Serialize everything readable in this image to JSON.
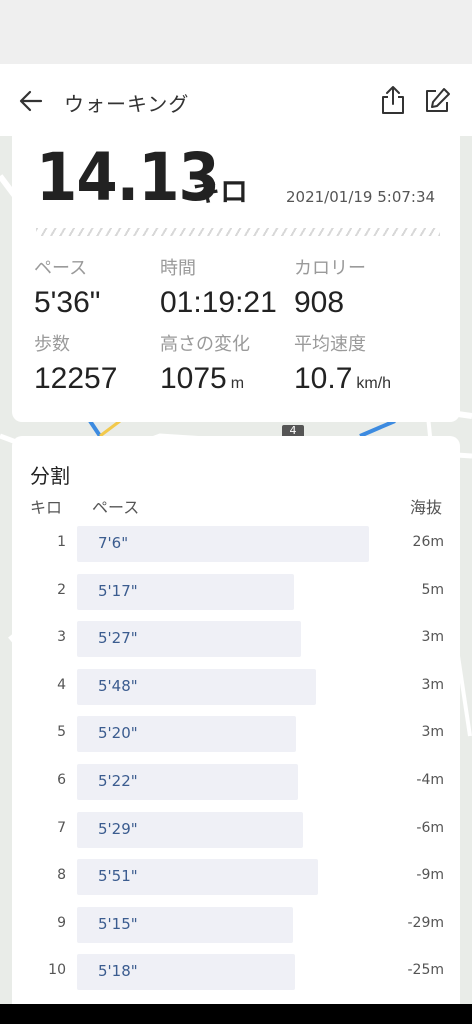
{
  "header": {
    "title": "ウォーキング"
  },
  "summary": {
    "distance": "14.13",
    "distance_unit": "キロ",
    "datetime": "2021/01/19 5:07:34",
    "stats": [
      {
        "label": "ペース",
        "value": "5'36\"",
        "unit": ""
      },
      {
        "label": "時間",
        "value": "01:19:21",
        "unit": ""
      },
      {
        "label": "カロリー",
        "value": "908",
        "unit": ""
      },
      {
        "label": "歩数",
        "value": "12257",
        "unit": ""
      },
      {
        "label": "高さの変化",
        "value": "1075",
        "unit": "m"
      },
      {
        "label": "平均速度",
        "value": "10.7",
        "unit": "km/h"
      }
    ]
  },
  "splits": {
    "title": "分割",
    "col_km": "キロ",
    "col_pace": "ペース",
    "col_elev": "海抜",
    "rows": [
      {
        "km": "1",
        "pace": "7'6\"",
        "pace_sec": 426,
        "elev": "26m"
      },
      {
        "km": "2",
        "pace": "5'17\"",
        "pace_sec": 317,
        "elev": "5m"
      },
      {
        "km": "3",
        "pace": "5'27\"",
        "pace_sec": 327,
        "elev": "3m"
      },
      {
        "km": "4",
        "pace": "5'48\"",
        "pace_sec": 348,
        "elev": "3m"
      },
      {
        "km": "5",
        "pace": "5'20\"",
        "pace_sec": 320,
        "elev": "3m"
      },
      {
        "km": "6",
        "pace": "5'22\"",
        "pace_sec": 322,
        "elev": "-4m"
      },
      {
        "km": "7",
        "pace": "5'29\"",
        "pace_sec": 329,
        "elev": "-6m"
      },
      {
        "km": "8",
        "pace": "5'51\"",
        "pace_sec": 351,
        "elev": "-9m"
      },
      {
        "km": "9",
        "pace": "5'15\"",
        "pace_sec": 315,
        "elev": "-29m"
      },
      {
        "km": "10",
        "pace": "5'18\"",
        "pace_sec": 318,
        "elev": "-25m"
      }
    ]
  },
  "map": {
    "route_badge": "4"
  }
}
